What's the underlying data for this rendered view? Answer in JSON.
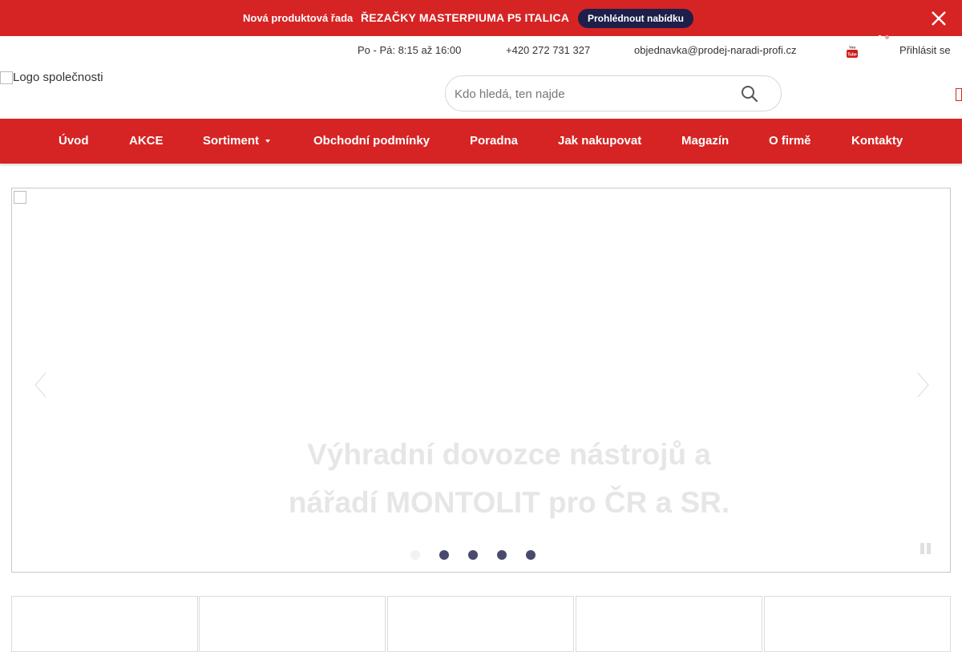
{
  "promo": {
    "pre_label": "Nová produktová řada",
    "headline": "ŘEZAČKY MASTERPIUMA P5 ITALICA",
    "cta_label": "Prohlédnout nabídku",
    "close_icon": "close-icon"
  },
  "contact": {
    "hours": "Po - Pá: 8:15 až 16:00",
    "phone": "+420 272 731 327",
    "email": "objednavka@prodej-naradi-profi.cz",
    "social_icon": "youtube-icon",
    "login_label": "Přihlásit se"
  },
  "header": {
    "logo_alt": "Logo společnosti",
    "search_placeholder": "Kdo hledá, ten najde",
    "search_icon": "search-icon",
    "cart_icon": "cart-icon"
  },
  "nav": {
    "items": [
      {
        "label": "Úvod"
      },
      {
        "label": "AKCE"
      },
      {
        "label": "Sortiment"
      },
      {
        "label": "Obchodní podmínky"
      },
      {
        "label": "Poradna"
      },
      {
        "label": "Jak nakupovat"
      },
      {
        "label": "Magazín"
      },
      {
        "label": "O firmě"
      },
      {
        "label": "Kontakty"
      }
    ]
  },
  "slider": {
    "caption_line1": "Výhradní dovozce nástrojů a",
    "caption_line2": "nářadí MONTOLIT pro ČR a SR.",
    "slide_count": 5,
    "active_slide": 1
  },
  "colors": {
    "brand_red": "#d62424",
    "cta_navy": "#1d1f4a"
  }
}
